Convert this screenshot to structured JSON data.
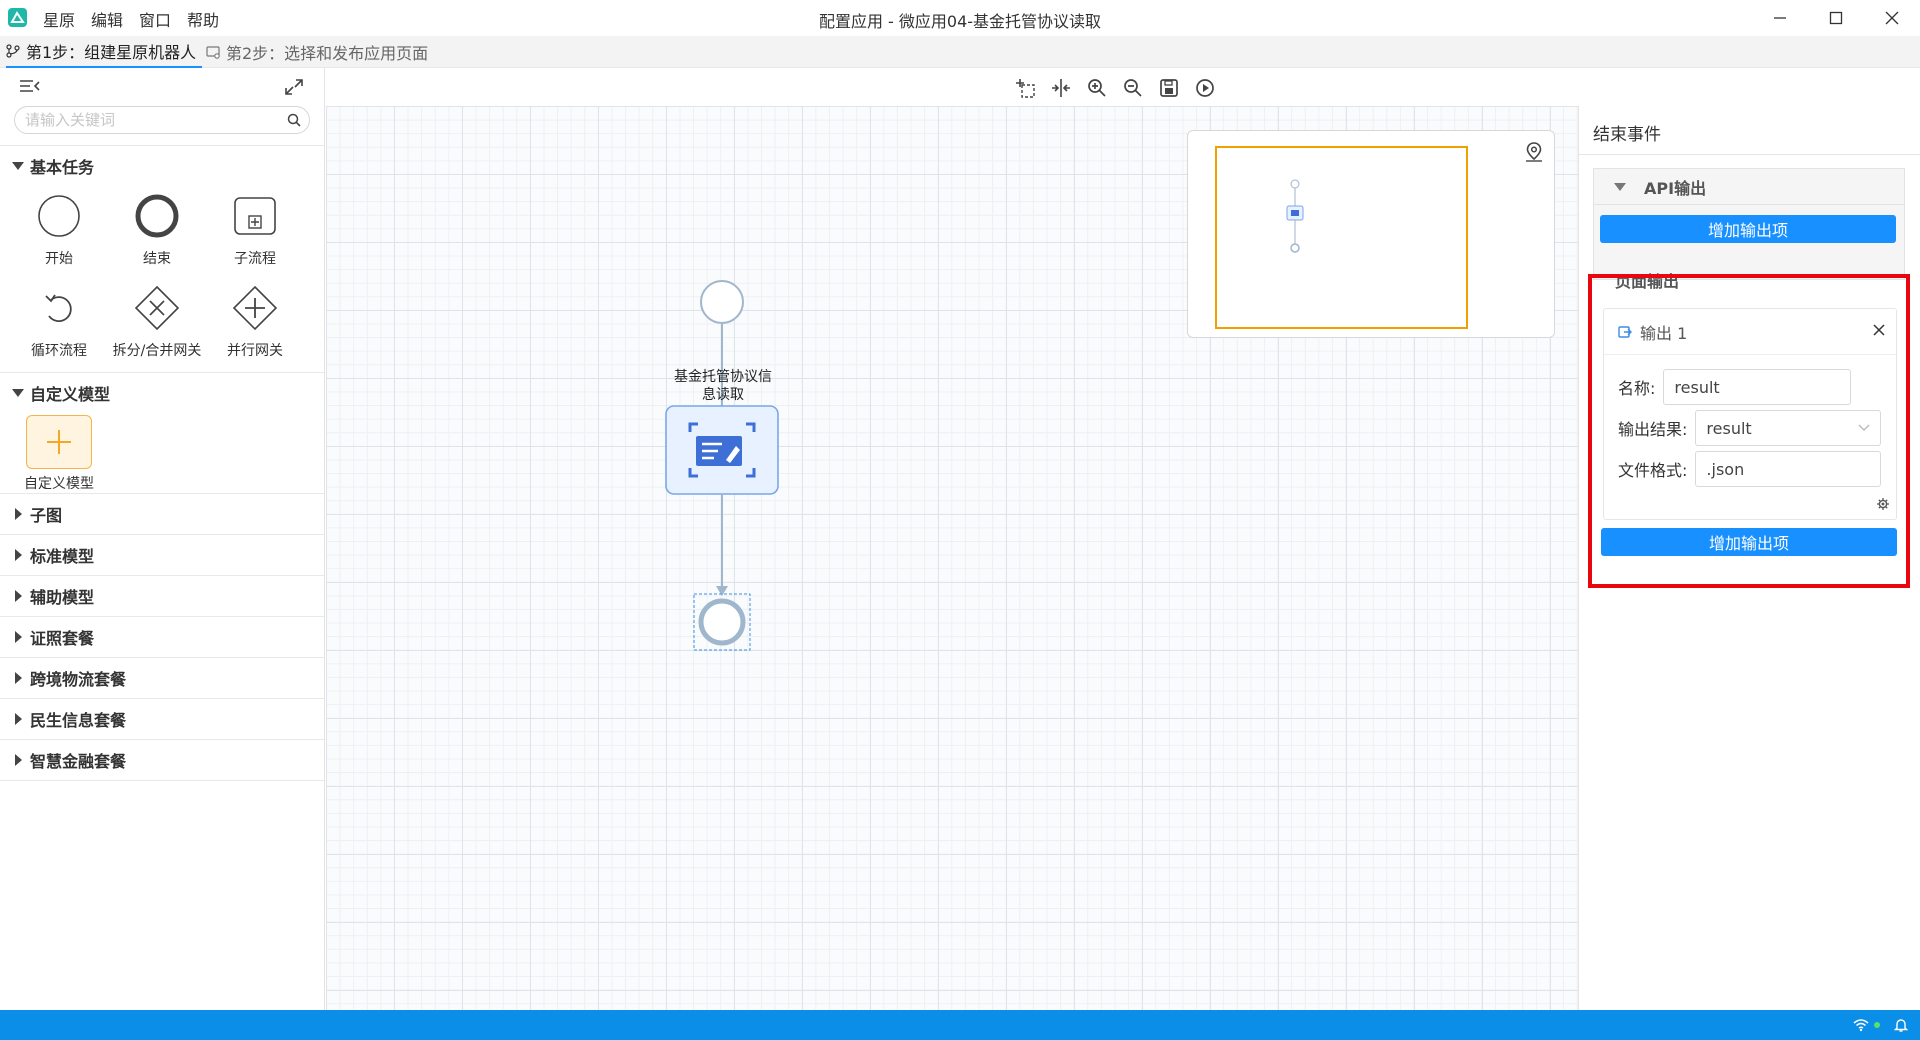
{
  "window": {
    "title": "配置应用 - 微应用04-基金托管协议读取",
    "menu": [
      "星原",
      "编辑",
      "窗口",
      "帮助"
    ]
  },
  "steps": [
    {
      "label": "第1步：组建星原机器人",
      "active": true
    },
    {
      "label": "第2步：选择和发布应用页面",
      "active": false
    }
  ],
  "left_panel": {
    "search_placeholder": "请输入关键词",
    "basic_tasks": {
      "title": "基本任务",
      "tools": [
        {
          "label": "开始",
          "icon": "start-event-icon"
        },
        {
          "label": "结束",
          "icon": "end-event-icon"
        },
        {
          "label": "子流程",
          "icon": "subprocess-icon"
        },
        {
          "label": "循环流程",
          "icon": "loop-icon"
        },
        {
          "label": "拆分/合并网关",
          "icon": "exclusive-gateway-icon"
        },
        {
          "label": "并行网关",
          "icon": "parallel-gateway-icon"
        }
      ]
    },
    "custom_models": {
      "title": "自定义模型",
      "item_label": "自定义模型"
    },
    "collapsed_sections": [
      "子图",
      "标准模型",
      "辅助模型",
      "证照套餐",
      "跨境物流套餐",
      "民生信息套餐",
      "智慧金融套餐"
    ]
  },
  "canvas": {
    "task_node_label_line1": "基金托管协议信",
    "task_node_label_line2": "息读取"
  },
  "right_panel": {
    "title": "结束事件",
    "api_output": {
      "title": "API输出",
      "add_button": "增加输出项"
    },
    "page_output": {
      "title": "页面输出",
      "card_title": "输出 1",
      "name_label": "名称:",
      "name_value": "result",
      "result_label": "输出结果:",
      "result_value": "result",
      "format_label": "文件格式:",
      "format_value": ".json",
      "add_button": "增加输出项"
    }
  },
  "colors": {
    "accent": "#1890ff",
    "highlight": "#e8070f",
    "status_bar": "#0b8ee8",
    "minimap_view": "#f0a000"
  }
}
